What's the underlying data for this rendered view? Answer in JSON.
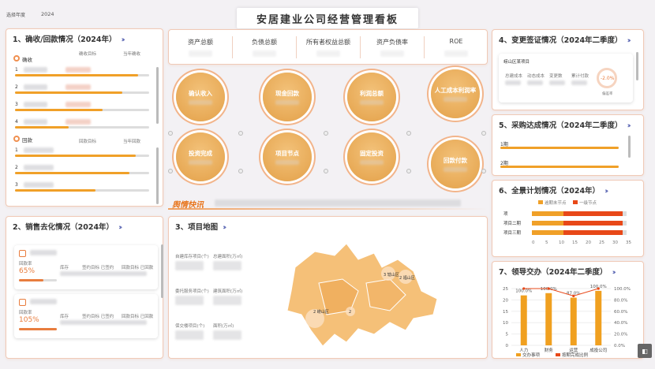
{
  "header": {
    "year_label": "选择年度",
    "year_value": "2024",
    "title": "安居建业公司经营管理看板"
  },
  "kpis": [
    "资产总额",
    "负债总额",
    "所有者权益总额",
    "资产负债率",
    "ROE"
  ],
  "circles": [
    "确认收入",
    "现金回款",
    "利润总额",
    "人工成本利润率",
    "投资完成",
    "项目节点",
    "固定投资",
    "回款付款"
  ],
  "panel1": {
    "title": "1、确收/回款情况（2024年）",
    "sec1": "确收",
    "sec2": "回款",
    "col_target": "确收目标",
    "col_current": "当年确收",
    "col_target2": "回款目标",
    "col_current2": "当年回款",
    "rows1": [
      "1",
      "2",
      "3",
      "4"
    ],
    "rows2": [
      "1",
      "2",
      "3"
    ]
  },
  "panel2": {
    "title": "2、销售去化情况（2024年）",
    "cards": [
      {
        "pct": "65%",
        "a": "回款率",
        "b": "库存",
        "c": "签约目标 已签约",
        "d": "回款目标 已回款"
      },
      {
        "pct": "105%",
        "a": "回款率",
        "b": "库存",
        "c": "签约目标 已签约",
        "d": "回款目标 已回款"
      }
    ]
  },
  "panel3": {
    "title": "3、项目地图",
    "labels": [
      "自建库存项目(个)",
      "总建面积(万㎡)",
      "委托服务项目(个)",
      "建筑面积(万㎡)",
      "保交楼项目(个)",
      "面积(万㎡)"
    ],
    "map_labels": [
      "3 辖山区",
      "3",
      "2 福山区",
      "2 崂山区",
      "2"
    ]
  },
  "news": {
    "label": "舆情快讯"
  },
  "panel4": {
    "title": "4、变更签证情况（2024年二季度）",
    "item": "崂山区某项目",
    "cols": [
      "总建成本",
      "动态成本",
      "变更数",
      "累计付款"
    ],
    "pct": "-2.0%",
    "pct_label": "偏差率"
  },
  "panel5": {
    "title": "5、采购达成情况（2024年二季度）",
    "rows": [
      "1期",
      "2期"
    ]
  },
  "panel6": {
    "title": "6、全景计划情况（2024年）",
    "legend1": "逾期未节点",
    "legend2": "一级节点",
    "ticks": [
      "0",
      "5",
      "10",
      "15",
      "20",
      "25",
      "30",
      "35"
    ],
    "rows": [
      "项",
      "项目二期",
      "项目三期"
    ]
  },
  "panel7": {
    "title": "7、领导交办（2024年二季度）",
    "legend1": "交办事项",
    "legend2": "按期完成比例"
  },
  "chart_data": {
    "type": "bar",
    "categories": [
      "人力",
      "财务",
      "运营",
      "成投公司"
    ],
    "series": [
      {
        "name": "交办事项",
        "values": [
          22,
          23,
          21,
          24
        ]
      },
      {
        "name": "按期完成比例",
        "values": [
          100,
          100,
          87.0,
          100
        ]
      }
    ],
    "bar_labels": [
      "100.0%",
      "100.0%",
      "87.0%",
      "100.0%"
    ],
    "ylim": [
      0,
      25
    ],
    "y2lim": [
      0,
      100
    ],
    "yticks": [
      "0",
      "5",
      "10",
      "15",
      "20",
      "25"
    ],
    "y2ticks": [
      "0.0%",
      "20.0%",
      "40.0%",
      "60.0%",
      "80.0%",
      "100.0%"
    ]
  }
}
